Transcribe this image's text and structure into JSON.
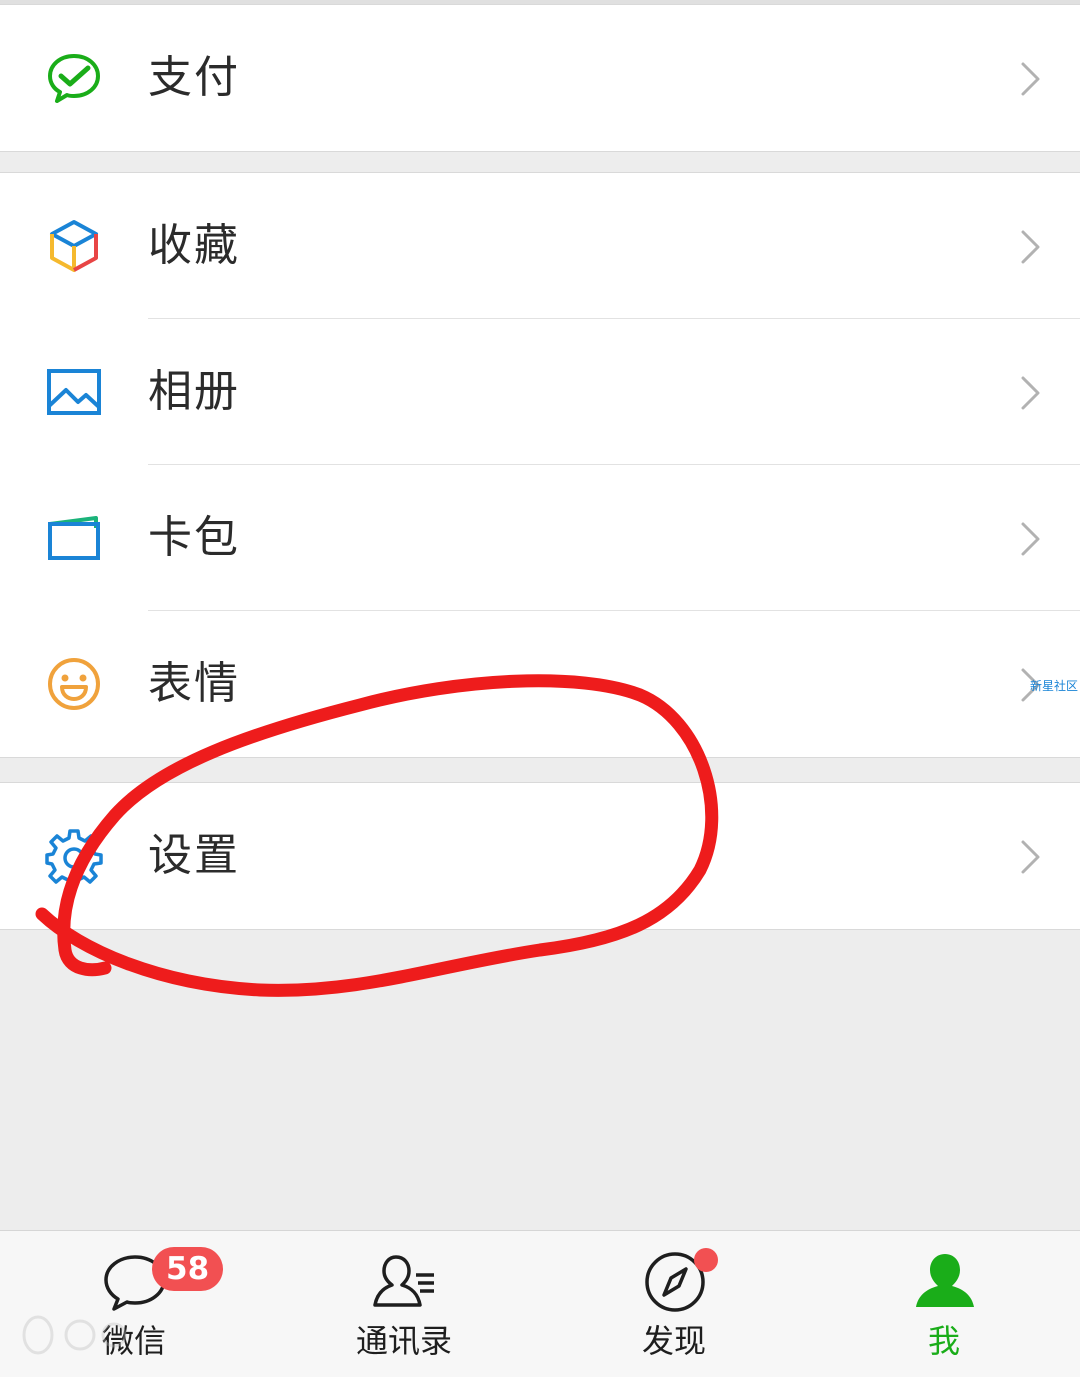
{
  "menu": {
    "pay": {
      "label": "支付",
      "icon": "wechat-pay-icon"
    },
    "favorites": {
      "label": "收藏",
      "icon": "favorites-cube-icon"
    },
    "album": {
      "label": "相册",
      "icon": "album-picture-icon"
    },
    "cards": {
      "label": "卡包",
      "icon": "card-wallet-icon"
    },
    "stickers": {
      "label": "表情",
      "icon": "smiley-icon"
    },
    "settings": {
      "label": "设置",
      "icon": "gear-icon"
    }
  },
  "side_watermark": "新星社区",
  "bottom_nav": {
    "chats": {
      "label": "微信",
      "badge": "58",
      "icon": "chat-bubble-icon"
    },
    "contacts": {
      "label": "通讯录",
      "icon": "contacts-icon"
    },
    "discover": {
      "label": "发现",
      "icon": "compass-icon"
    },
    "me": {
      "label": "我",
      "icon": "person-icon"
    }
  },
  "colors": {
    "accent_green": "#1aad19",
    "badge_red": "#f25052",
    "annotation_red": "#ee1c1c",
    "icon_blue": "#1a84d6",
    "icon_orange": "#f0a23c"
  }
}
